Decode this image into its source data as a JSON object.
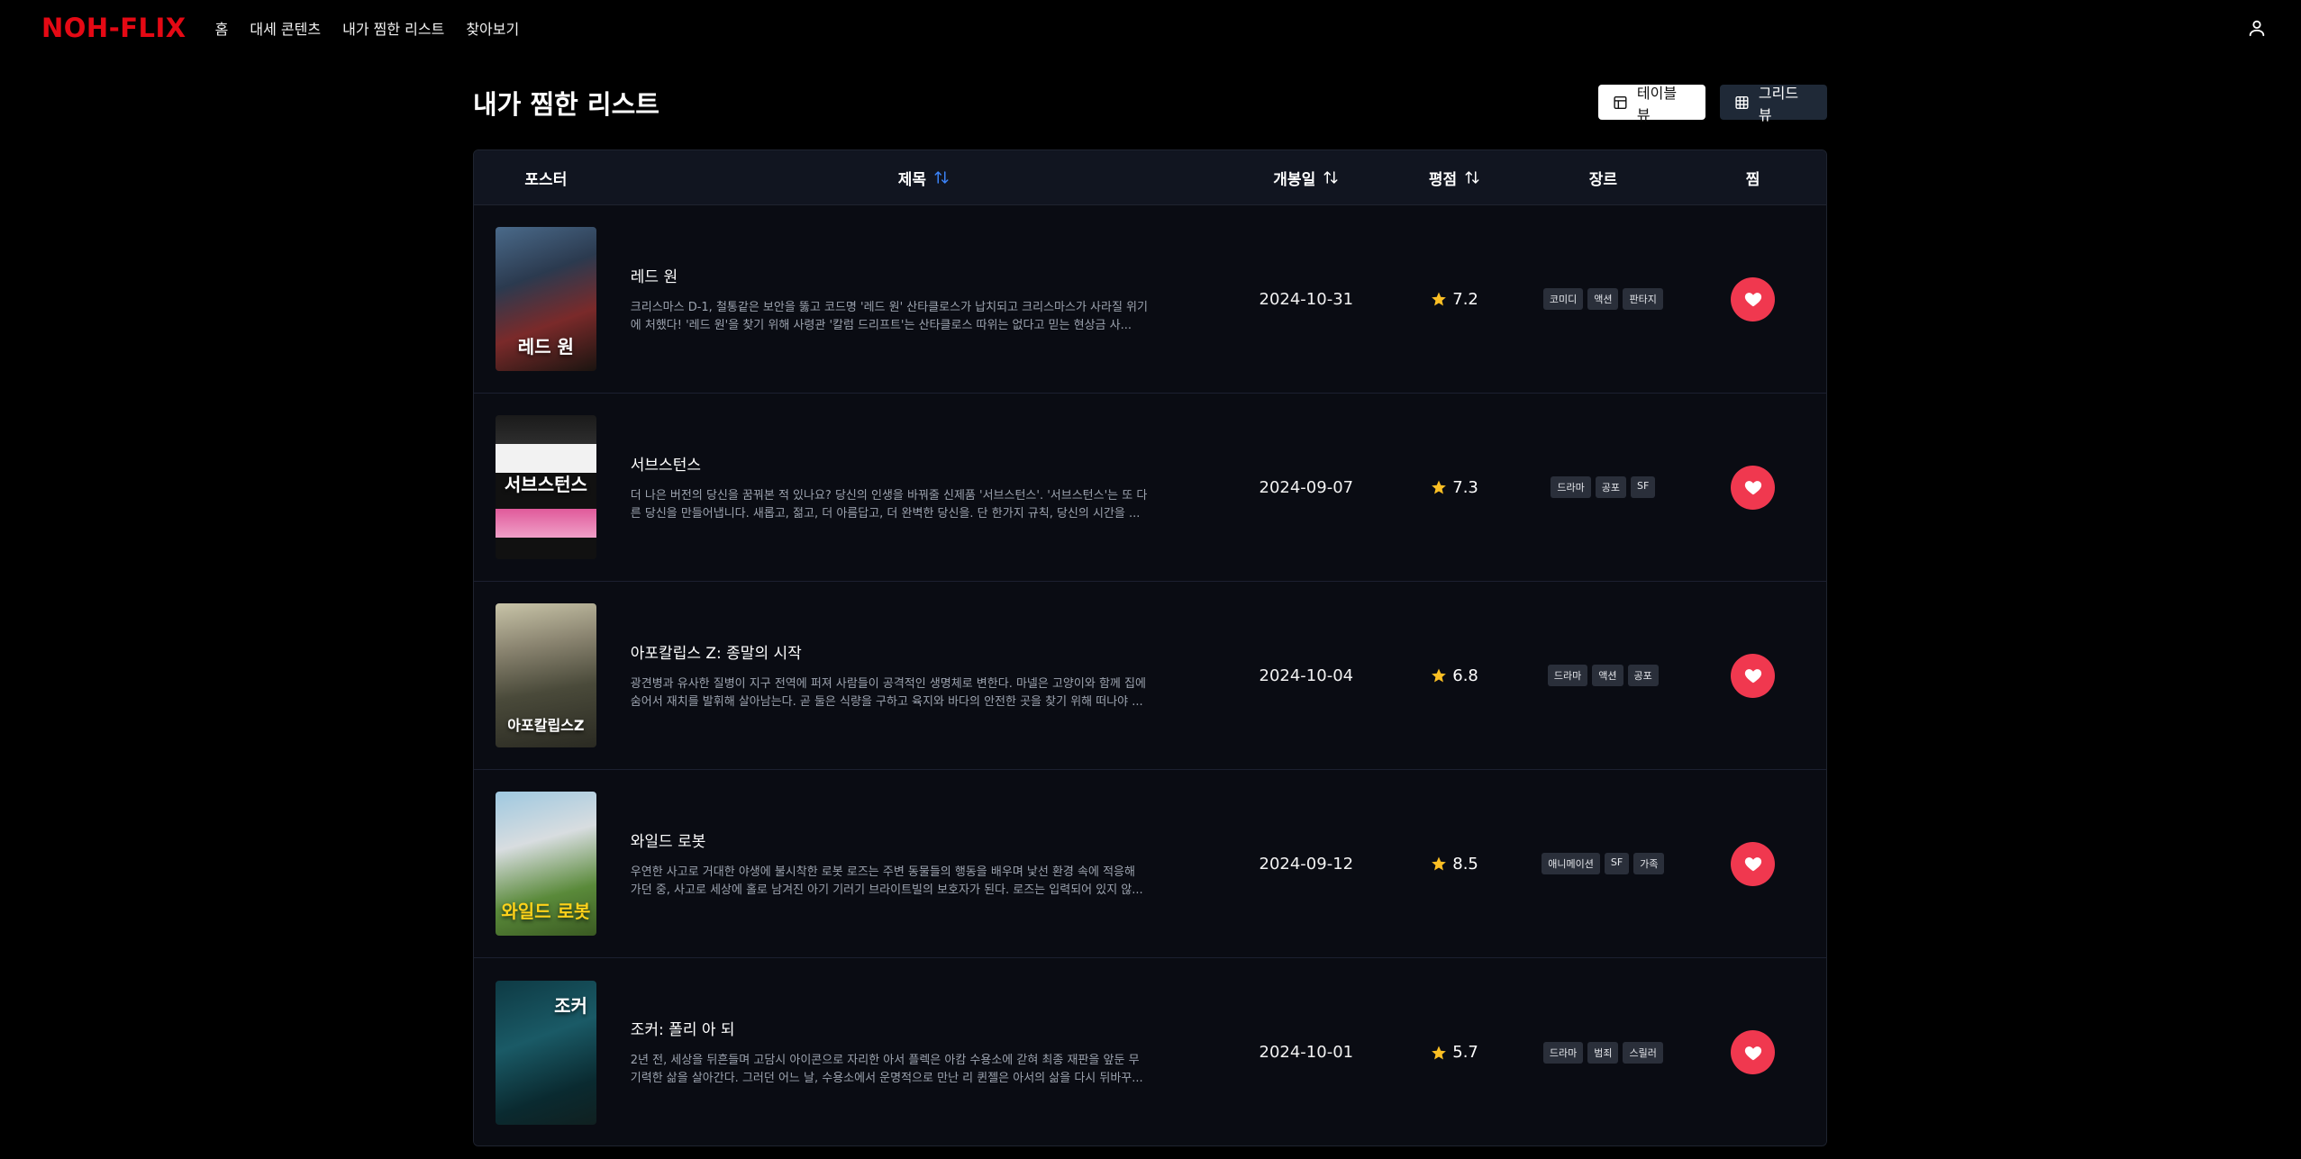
{
  "nav": {
    "logo": "NOH-FLIX",
    "links": [
      "홈",
      "대세 콘텐츠",
      "내가 찜한 리스트",
      "찾아보기"
    ]
  },
  "page": {
    "title": "내가 찜한 리스트",
    "table_view_label": "테이블 뷰",
    "grid_view_label": "그리드 뷰"
  },
  "table": {
    "headers": {
      "poster": "포스터",
      "title": "제목",
      "date": "개봉일",
      "rating": "평점",
      "genre": "장르",
      "fav": "찜"
    },
    "rows": [
      {
        "poster_text": "레드 원",
        "title": "레드 원",
        "desc": "크리스마스 D-1, 철통같은 보안을 뚫고 코드명 '레드 원' 산타클로스가 납치되고 크리스마스가 사라질 위기에 처했다! '레드 원'을 찾기 위해 사령관 '칼럼 드리프트'는 산타클로스 따위는 없다고 믿는 현상금 사...",
        "date": "2024-10-31",
        "rating": "7.2",
        "genres": [
          "코미디",
          "액션",
          "판타지"
        ]
      },
      {
        "poster_text": "서브스턴스",
        "title": "서브스턴스",
        "desc": "더 나은 버전의 당신을 꿈꿔본 적 있나요? 당신의 인생을 바꿔줄 신제품 '서브스턴스'. '서브스턴스'는 또 다른 당신을 만들어냅니다. 새롭고, 젊고, 더 아름답고, 더 완벽한 당신을. 단 한가지 규칙, 당신의 시간을 ...",
        "date": "2024-09-07",
        "rating": "7.3",
        "genres": [
          "드라마",
          "공포",
          "SF"
        ]
      },
      {
        "poster_text": "아포칼립스Z",
        "title": "아포칼립스 Z: 종말의 시작",
        "desc": "광견병과 유사한 질병이 지구 전역에 퍼져 사람들이 공격적인 생명체로 변한다. 마넬은 고양이와 함께 집에 숨어서 재치를 발휘해 살아남는다. 곧 둘은 식량을 구하고 육지와 바다의 안전한 곳을 찾기 위해 떠나야 ...",
        "date": "2024-10-04",
        "rating": "6.8",
        "genres": [
          "드라마",
          "액션",
          "공포"
        ]
      },
      {
        "poster_text": "와일드 로봇",
        "title": "와일드 로봇",
        "desc": "우연한 사고로 거대한 야생에 불시착한 로봇 로즈는 주변 동물들의 행동을 배우며 낯선 환경 속에 적응해 가던 중, 사고로 세상에 홀로 남겨진 아기 기러기 브라이트빌의 보호자가 된다. 로즈는 입력되어 있지 않...",
        "date": "2024-09-12",
        "rating": "8.5",
        "genres": [
          "애니메이션",
          "SF",
          "가족"
        ]
      },
      {
        "poster_text": "조커",
        "title": "조커: 폴리 아 되",
        "desc": "2년 전, 세상을 뒤흔들며 고담시 아이콘으로 자리한 아서 플렉은 아캄 수용소에 갇혀 최종 재판을 앞둔 무기력한 삶을 살아간다. 그러던 어느 날, 수용소에서 운명적으로 만난 리 퀸젤은 아서의 삶을 다시 뒤바꾸...",
        "date": "2024-10-01",
        "rating": "5.7",
        "genres": [
          "드라마",
          "범죄",
          "스릴러"
        ]
      }
    ]
  },
  "colors": {
    "brand": "#e50914",
    "fav": "#f0384f",
    "star": "#fbbf24",
    "active_sort": "#3b82f6"
  }
}
